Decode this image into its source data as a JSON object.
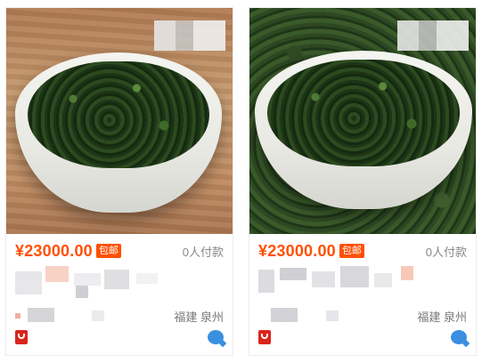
{
  "products": [
    {
      "price": "¥23000.00",
      "badge": "包邮",
      "sales": "0人付款",
      "location": "福建 泉州"
    },
    {
      "price": "¥23000.00",
      "badge": "包邮",
      "sales": "0人付款",
      "location": "福建 泉州"
    }
  ],
  "colors": {
    "price": "#ff5000",
    "badge_bg": "#ff5000",
    "shop_icon": "#d9261c",
    "chat_icon": "#3a8fe0"
  },
  "icons": [
    "shop-icon",
    "chat-icon"
  ]
}
